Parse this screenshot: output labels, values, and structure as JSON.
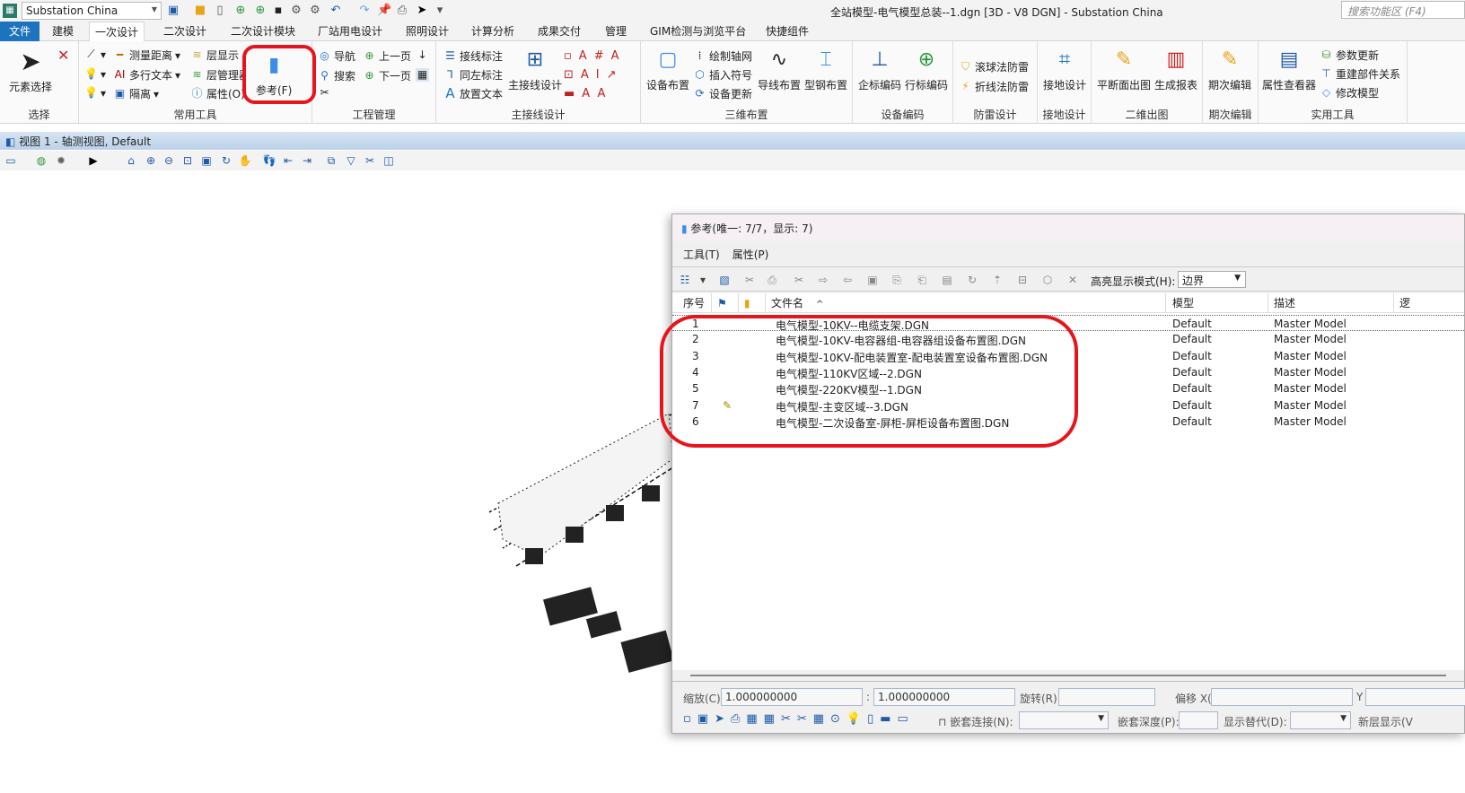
{
  "titlebar": {
    "workspace": "Substation China",
    "window_title": "全站模型-电气模型总装--1.dgn [3D - V8 DGN] - Substation China",
    "search_placeholder": "搜索功能区 (F4)"
  },
  "tabs": [
    "文件",
    "建模",
    "一次设计",
    "二次设计",
    "二次设计模块",
    "厂站用电设计",
    "照明设计",
    "计算分析",
    "成果交付",
    "管理",
    "GIM检测与浏览平台",
    "快捷组件"
  ],
  "active_tab": "一次设计",
  "ribbon": {
    "select": {
      "label": "选择",
      "big": "元素选择"
    },
    "common": {
      "label": "常用工具",
      "items": [
        "测量距离",
        "多行文本",
        "隔离",
        "层显示",
        "层管理器(M)",
        "属性(O)"
      ],
      "reference": "参考(F)"
    },
    "project": {
      "label": "工程管理",
      "items": [
        "导航",
        "搜索",
        "上一页",
        "下一页"
      ]
    },
    "wiring": {
      "label": "主接线设计",
      "items": [
        "接线标注",
        "同左标注",
        "放置文本"
      ],
      "big": "主接线设计"
    },
    "layout3d": {
      "label": "三维布置",
      "items": [
        "设备布置",
        "绘制轴网",
        "插入符号",
        "设备更新",
        "导线布置",
        "型钢布置"
      ]
    },
    "coding": {
      "label": "设备编码",
      "items": [
        "企标编码",
        "行标编码"
      ]
    },
    "lightning": {
      "label": "防雷设计",
      "items": [
        "滚球法防雷",
        "折线法防雷"
      ]
    },
    "grounding": {
      "label": "接地设计",
      "items": [
        "接地设计"
      ]
    },
    "drawing2d": {
      "label": "二维出图",
      "items": [
        "平断面出图",
        "生成报表"
      ]
    },
    "phase": {
      "label": "期次编辑",
      "items": [
        "期次编辑"
      ]
    },
    "utils": {
      "label": "实用工具",
      "items": [
        "属性查看器",
        "参数更新",
        "重建部件关系",
        "修改模型"
      ]
    }
  },
  "view": {
    "title": "视图 1 - 轴测视图, Default"
  },
  "dialog": {
    "title": "参考(唯一: 7/7，显示: 7)",
    "menu": [
      "工具(T)",
      "属性(P)"
    ],
    "highlight_label": "高亮显示模式(H):",
    "highlight_value": "边界",
    "columns": [
      "序号",
      "文件名",
      "模型",
      "描述",
      "逻"
    ],
    "rows": [
      {
        "no": "1",
        "file": "电气模型-10KV--电缆支架.DGN",
        "model": "Default",
        "desc": "Master Model",
        "flag": ""
      },
      {
        "no": "2",
        "file": "电气模型-10KV-电容器组-电容器组设备布置图.DGN",
        "model": "Default",
        "desc": "Master Model",
        "flag": ""
      },
      {
        "no": "3",
        "file": "电气模型-10KV-配电装置室-配电装置室设备布置图.DGN",
        "model": "Default",
        "desc": "Master Model",
        "flag": ""
      },
      {
        "no": "4",
        "file": "电气模型-110KV区域--2.DGN",
        "model": "Default",
        "desc": "Master Model",
        "flag": ""
      },
      {
        "no": "5",
        "file": "电气模型-220KV模型--1.DGN",
        "model": "Default",
        "desc": "Master Model",
        "flag": ""
      },
      {
        "no": "7",
        "file": "电气模型-主变区域--3.DGN",
        "model": "Default",
        "desc": "Master Model",
        "flag": "pencil"
      },
      {
        "no": "6",
        "file": "电气模型-二次设备室-屏柜-屏柜设备布置图.DGN",
        "model": "Default",
        "desc": "Master Model",
        "flag": ""
      }
    ],
    "bottom": {
      "scale_label": "缩放(C)",
      "scale1": "1.000000000",
      "colon": ":",
      "scale2": "1.000000000",
      "rotate_label": "旋转(R)",
      "offset_label": "偏移 X(X)",
      "y_label": "Y",
      "nest_label": "嵌套连接(N):",
      "depth_label": "嵌套深度(P):",
      "display_label": "显示替代(D):",
      "newlevel_label": "新层显示(V"
    }
  },
  "colors": {
    "accent": "#1e73be",
    "highlight": "#e8141c"
  }
}
